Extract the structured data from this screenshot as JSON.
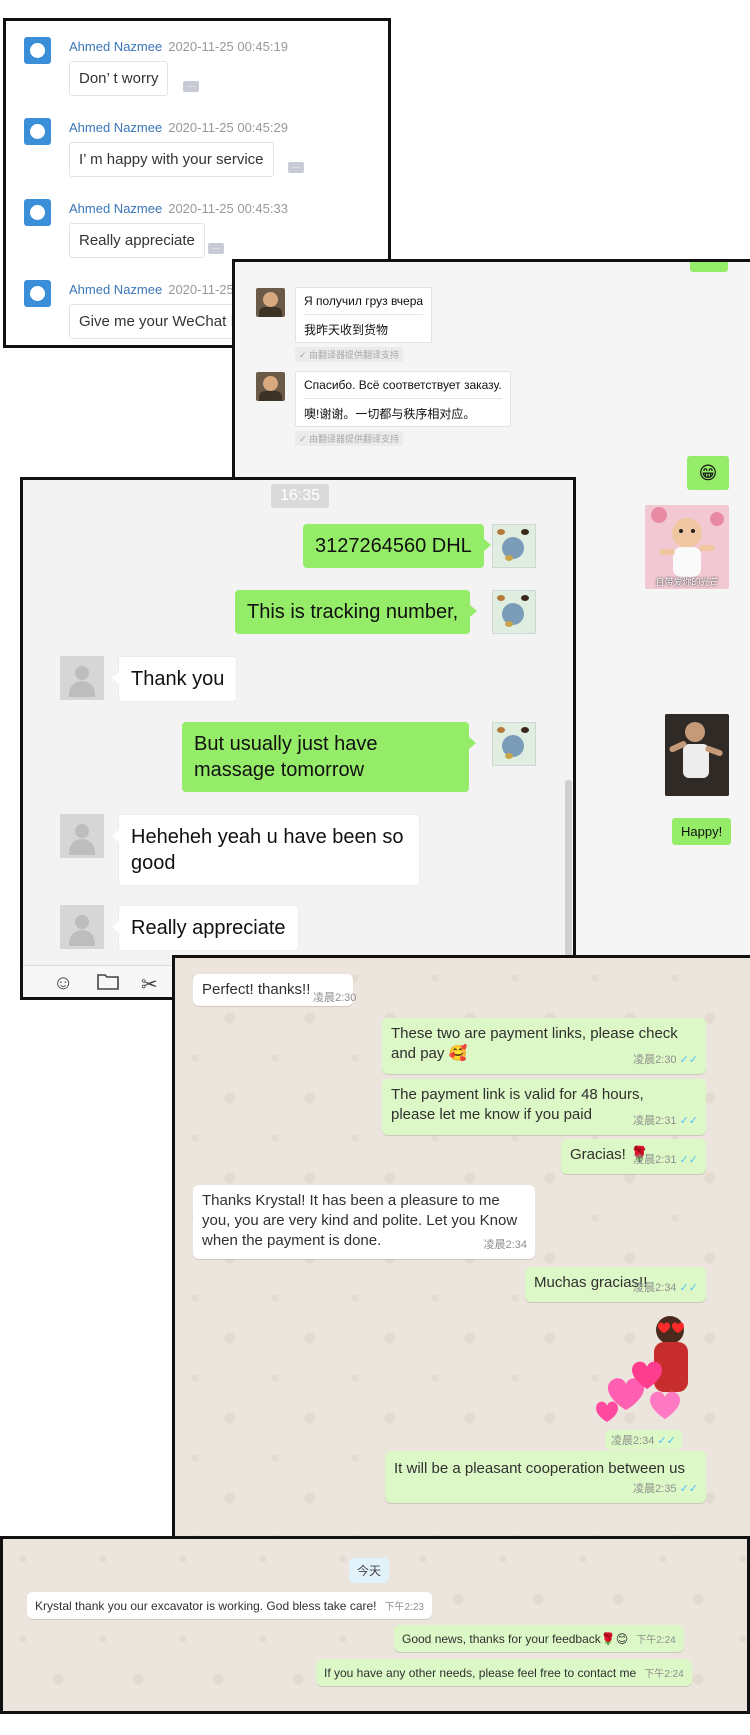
{
  "panel1": {
    "messages": [
      {
        "name": "Ahmed Nazmee",
        "time": "2020-11-25 00:45:19",
        "text": "Don’ t worry"
      },
      {
        "name": "Ahmed Nazmee",
        "time": "2020-11-25 00:45:29",
        "text": "I’ m happy with your service"
      },
      {
        "name": "Ahmed Nazmee",
        "time": "2020-11-25 00:45:33",
        "text": "Really appreciate"
      },
      {
        "name": "Ahmed Nazmee",
        "time": "2020-11-25",
        "text": "Give me your WeChat I"
      }
    ],
    "more_label": "..."
  },
  "panel2": {
    "messages": [
      {
        "original": "Я получил груз вчера",
        "translation": "我昨天收到货物",
        "note": "✓ 由翻译器提供翻译支持"
      },
      {
        "original": "Спасибо. Всё соответствует заказу.",
        "translation": "噢!谢谢。一切都与秩序相对应。",
        "note": "✓ 由翻译器提供翻译支持"
      }
    ],
    "emoji_message": "😁",
    "sticker_caption": "自带爱你的光芒",
    "happy_message": "Happy!"
  },
  "panel3": {
    "time_label": "16:35",
    "messages": [
      {
        "side": "out",
        "text": "3127264560 DHL"
      },
      {
        "side": "out",
        "text": "This is tracking number,"
      },
      {
        "side": "in",
        "text": "Thank you"
      },
      {
        "side": "out",
        "text": "But usually just have massage tomorrow"
      },
      {
        "side": "in",
        "text": "Heheheh yeah u have been so good"
      },
      {
        "side": "in",
        "text": "Really appreciate"
      }
    ],
    "toolbar_icons": [
      "emoji-icon",
      "folder-icon",
      "scissors-icon"
    ]
  },
  "panel4": {
    "messages": [
      {
        "side": "in",
        "text": "Perfect! thanks!!",
        "time": "凌晨2:30"
      },
      {
        "side": "out",
        "text": "These two are payment links, please check and pay 🥰",
        "time": "凌晨2:30"
      },
      {
        "side": "out",
        "text": "The payment link is valid for 48 hours, please let me know if you paid",
        "time": "凌晨2:31"
      },
      {
        "side": "out",
        "text": "Gracias! 🌹",
        "time": "凌晨2:31"
      },
      {
        "side": "in",
        "text": "Thanks Krystal! It has been a pleasure to me you, you are very kind and polite. Let you Know when the payment is done.",
        "time": "凌晨2:34"
      },
      {
        "side": "out",
        "text": "Muchas gracias!!",
        "time": "凌晨2:34"
      },
      {
        "side": "out",
        "text": "",
        "time": "凌晨2:34"
      },
      {
        "side": "out",
        "text": "It will be a pleasant cooperation between us",
        "time": "凌晨2:35"
      }
    ],
    "tick": "✓✓"
  },
  "panel5": {
    "day_label": "今天",
    "messages": [
      {
        "side": "in",
        "text": "Krystal thank you our excavator is working. God bless take care!",
        "time": "下午2:23"
      },
      {
        "side": "out",
        "text": "Good news, thanks for your feedback🌹😊",
        "time": "下午2:24"
      },
      {
        "side": "out",
        "text": "If you have any other needs, please feel free to contact me",
        "time": "下午2:24"
      }
    ]
  },
  "colors": {
    "wechat_green": "#95ec69",
    "whatsapp_out": "#dcf8c6",
    "whatsapp_bg": "#ece5dd",
    "link_blue": "#3a76b8"
  }
}
